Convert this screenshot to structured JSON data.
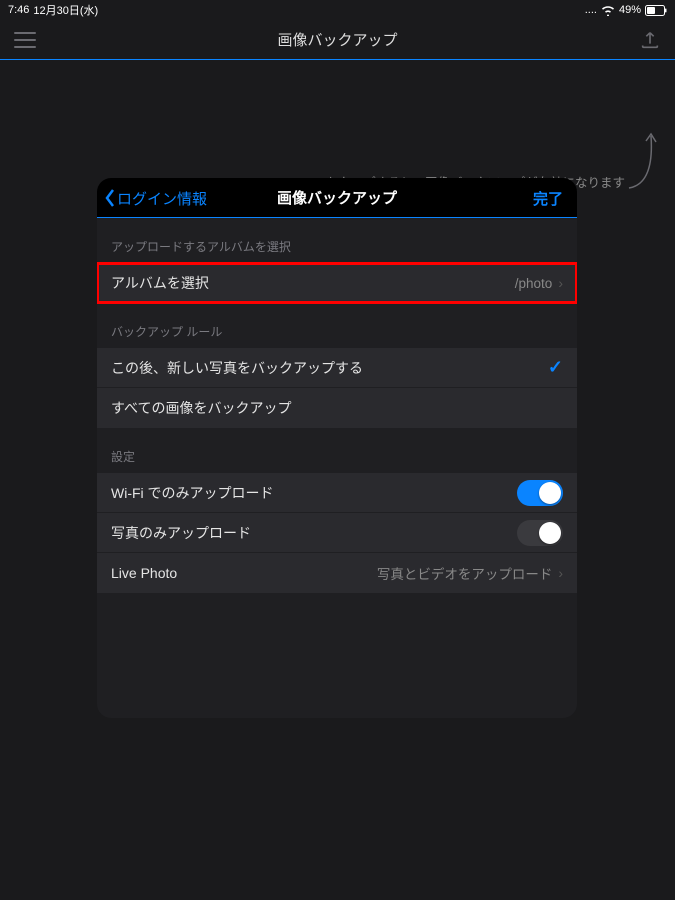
{
  "status": {
    "time": "7:46",
    "date": "12月30日(水)",
    "battery": "49%"
  },
  "nav": {
    "title": "画像バックアップ"
  },
  "hint": "ここをタップすると、画像バックアップが有効になります",
  "modal": {
    "back_label": "ログイン情報",
    "title": "画像バックアップ",
    "done_label": "完了",
    "section_album": "アップロードするアルバムを選択",
    "row_album_label": "アルバムを選択",
    "row_album_value": "/photo",
    "section_rule": "バックアップ ルール",
    "rule_new": "この後、新しい写真をバックアップする",
    "rule_all": "すべての画像をバックアップ",
    "section_settings": "設定",
    "setting_wifi": "Wi-Fi でのみアップロード",
    "setting_photo_only": "写真のみアップロード",
    "setting_live_label": "Live Photo",
    "setting_live_value": "写真とビデオをアップロード"
  }
}
